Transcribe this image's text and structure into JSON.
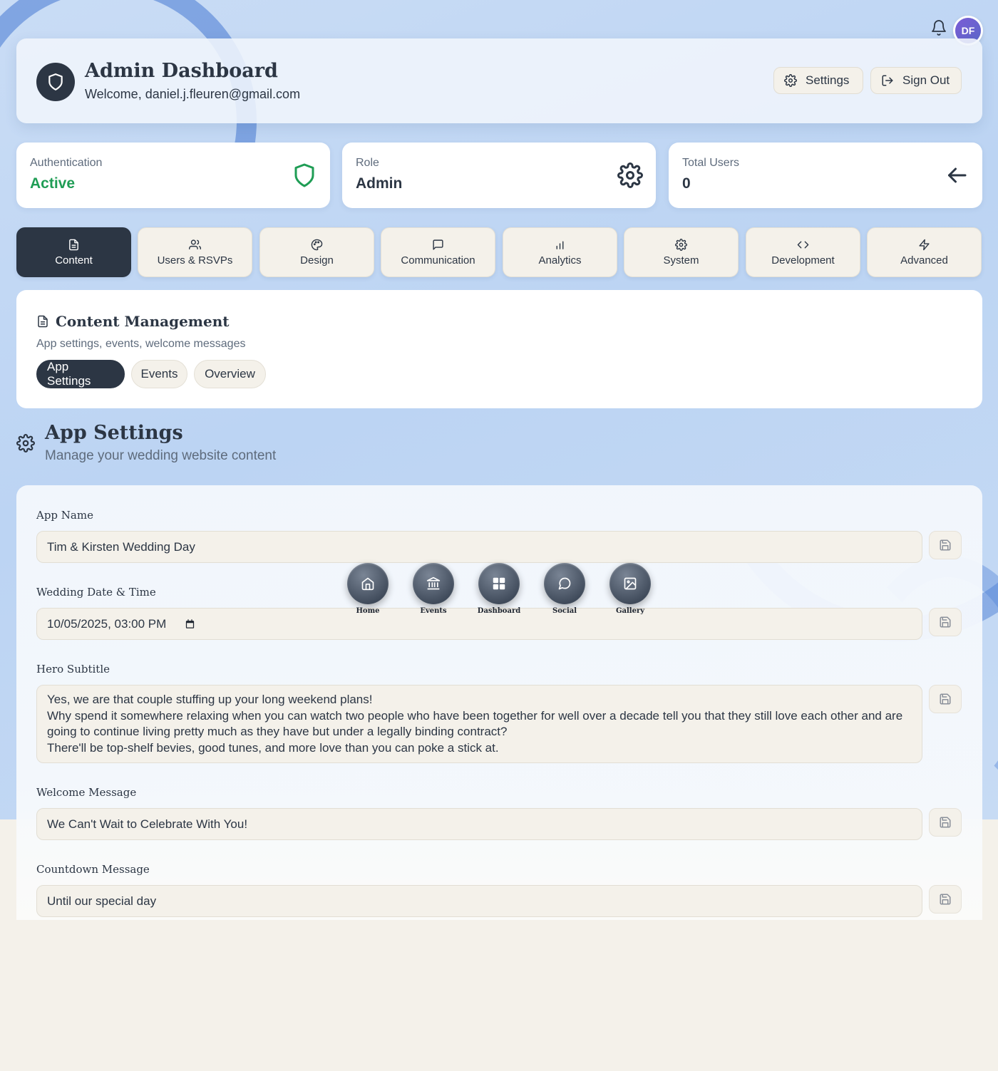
{
  "header": {
    "title": "Admin Dashboard",
    "welcome": "Welcome, daniel.j.fleuren@gmail.com",
    "settings_label": "Settings",
    "signout_label": "Sign Out"
  },
  "user": {
    "initials": "DF"
  },
  "stats": [
    {
      "label": "Authentication",
      "value": "Active",
      "color": "#1f9d55"
    },
    {
      "label": "Role",
      "value": "Admin"
    },
    {
      "label": "Total Users",
      "value": "0"
    }
  ],
  "tabs": [
    {
      "label": "Content",
      "icon": "document-icon",
      "active": true
    },
    {
      "label": "Users & RSVPs",
      "icon": "users-icon"
    },
    {
      "label": "Design",
      "icon": "palette-icon"
    },
    {
      "label": "Communication",
      "icon": "message-icon"
    },
    {
      "label": "Analytics",
      "icon": "bar-chart-icon"
    },
    {
      "label": "System",
      "icon": "gear-icon"
    },
    {
      "label": "Development",
      "icon": "code-icon"
    },
    {
      "label": "Advanced",
      "icon": "lightning-icon"
    }
  ],
  "content_mgmt": {
    "title": "Content Management",
    "description": "App settings, events, welcome messages",
    "subtabs": [
      "App Settings",
      "Events",
      "Overview"
    ]
  },
  "app_settings": {
    "title": "App Settings",
    "subtitle": "Manage your wedding website content",
    "fields": {
      "app_name": {
        "label": "App Name",
        "value": "Tim & Kirsten Wedding Day"
      },
      "wedding_date": {
        "label": "Wedding Date & Time",
        "value": "10/05/2025, 03:00 PM"
      },
      "hero_subtitle": {
        "label": "Hero Subtitle",
        "value": "Yes, we are that couple stuffing up your long weekend plans!\nWhy spend it somewhere relaxing when you can watch two people who have been together for well over a decade tell you that they still love each other and are going to continue living pretty much as they have but under a legally binding contract?\nThere'll be top-shelf bevies, good tunes, and more love than you can poke a stick at."
      },
      "welcome_message": {
        "label": "Welcome Message",
        "value": "We Can't Wait to Celebrate With You!"
      },
      "countdown_message": {
        "label": "Countdown Message",
        "value": "Until our special day"
      }
    }
  },
  "floating_nav": [
    "Home",
    "Events",
    "Dashboard",
    "Social",
    "Gallery"
  ],
  "colors": {
    "accent": "#2c3644",
    "success": "#1f9d55",
    "panel": "#f4f1ea"
  }
}
